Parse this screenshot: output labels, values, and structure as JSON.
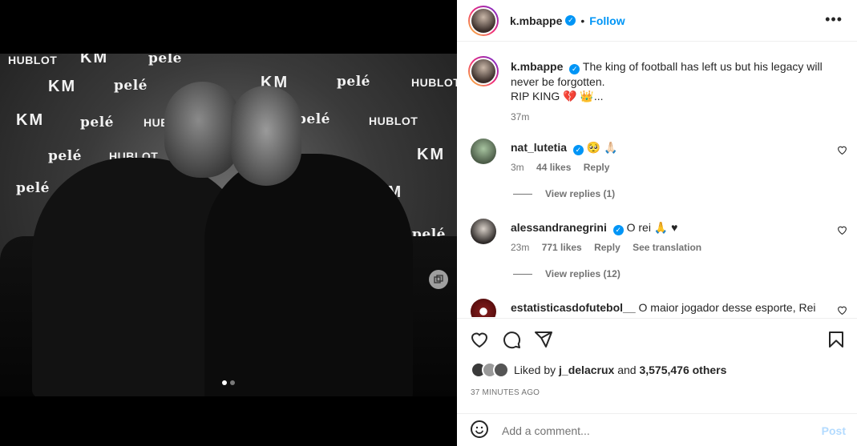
{
  "post": {
    "username": "k.mbappe",
    "follow_label": "Follow",
    "separator": "•",
    "caption_line1": "The king of football has left us but his legacy will never be forgotten.",
    "caption_line2": "RIP KING 💔 👑...",
    "caption_time": "37m",
    "likes_text_prefix": "Liked by",
    "likes_user": "j_delacrux",
    "likes_and": "and",
    "likes_count": "3,575,476 others",
    "time_ago": "37 MINUTES AGO",
    "add_comment_placeholder": "Add a comment...",
    "post_label": "Post",
    "photo_index": 1,
    "photo_total": 2
  },
  "wall_logos": {
    "hublot": "HUBLOT",
    "km": "KM",
    "pele": "pelé"
  },
  "comments": [
    {
      "user": "nat_lutetia",
      "text": "🥺 🙏🏻",
      "time": "3m",
      "likes": "44 likes",
      "reply": "Reply",
      "view_replies": "View replies (1)"
    },
    {
      "user": "alessandranegrini",
      "text": "O rei 🙏 ♥",
      "time": "23m",
      "likes": "771 likes",
      "reply": "Reply",
      "translate": "See translation",
      "view_replies": "View replies (12)"
    },
    {
      "user": "estatisticasdofutebol__",
      "text": "O maior jogador desse esporte, Rei"
    }
  ],
  "colors": {
    "accent": "#0095f6",
    "muted": "#737373",
    "post_disabled": "#b3dbff"
  },
  "icons": [
    "more-icon",
    "heart-icon",
    "comment-icon",
    "share-icon",
    "bookmark-icon",
    "emoji-icon",
    "verified-badge-icon",
    "carousel-stack-icon"
  ]
}
